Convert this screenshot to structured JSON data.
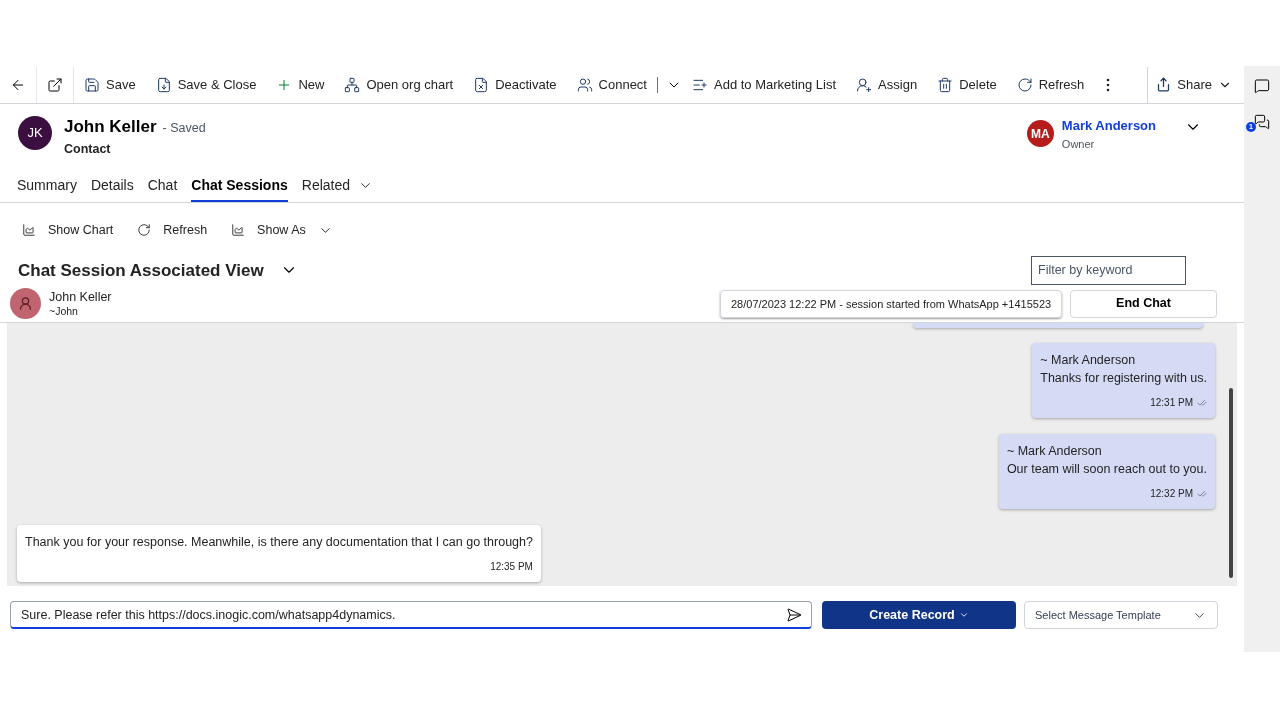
{
  "toolbar": {
    "items": [
      {
        "kind": "icon"
      },
      {
        "kind": "icon"
      },
      {
        "kind": "command",
        "label": "Save"
      },
      {
        "kind": "command",
        "label": "Save & Close"
      },
      {
        "kind": "command",
        "label": "New"
      },
      {
        "kind": "command",
        "label": "Open org chart"
      },
      {
        "kind": "command",
        "label": "Deactivate"
      },
      {
        "kind": "command",
        "label": "Connect"
      },
      {
        "kind": "split"
      },
      {
        "kind": "command",
        "label": "Add to Marketing List"
      },
      {
        "kind": "command",
        "label": "Assign"
      },
      {
        "kind": "command",
        "label": "Delete"
      },
      {
        "kind": "command",
        "label": "Refresh"
      },
      {
        "kind": "more"
      }
    ],
    "share": "Share"
  },
  "record": {
    "initials": "JK",
    "name": "John Keller",
    "status": "- Saved",
    "entity": "Contact"
  },
  "owner": {
    "initials": "MA",
    "name": "Mark Anderson",
    "role": "Owner"
  },
  "tabs": [
    {
      "label": "Summary",
      "selected": false
    },
    {
      "label": "Details",
      "selected": false
    },
    {
      "label": "Chat",
      "selected": false
    },
    {
      "label": "Chat Sessions",
      "selected": true
    },
    {
      "label": "Related",
      "selected": false,
      "dropdown": true
    }
  ],
  "view_toolbar": [
    "Show Chart",
    "Refresh",
    "Show As"
  ],
  "view_title": "Chat Session Associated View",
  "filter": {
    "placeholder": "Filter by keyword"
  },
  "contact": {
    "name": "John Keller",
    "handle": "~John"
  },
  "session": "28/07/2023 12:22 PM - session started from WhatsApp +1415523",
  "end_chat": "End Chat",
  "messages": [
    {
      "kind": "outgoing",
      "sender": "~ Mark Anderson",
      "text": "Thanks for registering with us.",
      "time": "12:31 PM",
      "read": true
    },
    {
      "kind": "outgoing",
      "sender": "~ Mark Anderson",
      "text": "Our team will soon reach out to you.",
      "time": "12:32 PM",
      "read": true
    },
    {
      "kind": "incoming",
      "text": "Thank you for your response. Meanwhile, is there any documentation that I can go through?",
      "time": "12:35 PM"
    }
  ],
  "composer": {
    "value": "Sure. Please refer this https://docs.inogic.com/whatsapp4dynamics."
  },
  "create_record": "Create Record",
  "template": {
    "placeholder": "Select Message Template"
  },
  "rail": {
    "badge": "1"
  }
}
